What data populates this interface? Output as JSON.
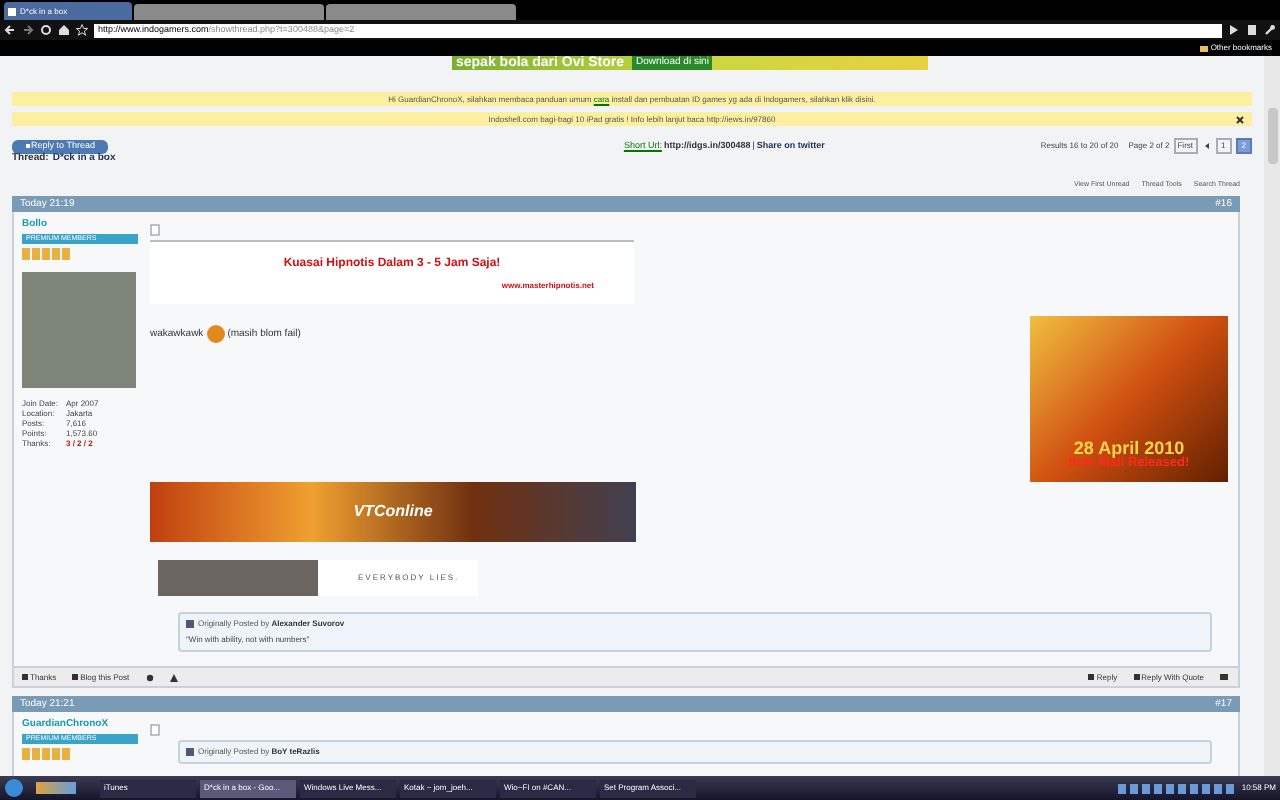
{
  "browser": {
    "tabs": [
      {
        "label": "D*ck in a box",
        "selected": true
      }
    ],
    "address_host": "http://www.indogamers.com",
    "address_path": "/showthread.php?t=300488&page=2",
    "bookmarks": [
      "Other bookmarks"
    ]
  },
  "ad_banner": {
    "text": "sepak bola dari Ovi Store",
    "button": "Download di sini"
  },
  "notices": [
    {
      "before": "Hi GuardianChronoX, silahkan membaca panduan umum ",
      "link": "cara",
      "after": " install dan pembuatan ID games yg ada di Indogamers, silahkan klik disini.",
      "closable": false
    },
    {
      "before": "Indoshell.com bagi-bagi 10 iPad gratis ! Info lebih lanjut baca http://iews.in/97860",
      "closable": true
    }
  ],
  "thread_bar": {
    "reply_button": "Reply to Thread",
    "short_url_label": "Short Url:",
    "short_url": "http://idgs.in/300488",
    "separator": "|",
    "share": "Share on twitter",
    "results": "Results 16 to 20 of 20",
    "page_label": "Page 2 of 2",
    "first": "First",
    "pages": [
      {
        "label": "1",
        "selected": false
      },
      {
        "label": "2",
        "selected": true
      }
    ]
  },
  "thread_title": {
    "label": "Thread:",
    "title": "D*ck in a box"
  },
  "thread_tools": [
    "View First Unread",
    "Thread Tools",
    "Search Thread"
  ],
  "posts": [
    {
      "date": "Today 21:19",
      "number": "#16",
      "user": "Bollo",
      "rank": "PREMIUM MEMBERS",
      "info": [
        {
          "label": "Join Date:",
          "value": "Apr 2007"
        },
        {
          "label": "Location:",
          "value": "Jakarta"
        },
        {
          "label": "Posts:",
          "value": "7,616"
        },
        {
          "label": "Points:",
          "value": "1,573.60"
        },
        {
          "label": "Thanks:",
          "value": "3 / 2 / 2"
        }
      ],
      "ad": {
        "title": "Kuasai Hipnotis Dalam 3 - 5 Jam Saja!",
        "url": "www.masterhipnotis.net"
      },
      "text": "wakawkawk",
      "text_after": "(masih blom fail)",
      "side_image": {
        "date": "28 April 2010",
        "caption": "Item Mall Released!"
      },
      "signature_banner": "VTConline",
      "signature_caption": "EVERYBODY LIES.",
      "quote": {
        "prefix": "Originally Posted by",
        "author": "Alexander Suvorov",
        "text": "\"Win with ability, not with numbers\""
      },
      "footer_left": [
        "Thanks",
        "Blog this Post"
      ],
      "footer_right": [
        "Reply",
        "Reply With Quote"
      ]
    },
    {
      "date": "Today 21:21",
      "number": "#17",
      "user": "GuardianChronoX",
      "rank": "PREMIUM MEMBERS",
      "quote": {
        "prefix": "Originally Posted by",
        "author": "BoY teRazlis"
      }
    }
  ],
  "taskbar": {
    "items": [
      {
        "label": "iTunes",
        "selected": false
      },
      {
        "label": "D*ck in a box - Goo...",
        "selected": true
      },
      {
        "label": "Windows Live Mess...",
        "selected": false
      },
      {
        "label": "Kotak ~ jom_joeh...",
        "selected": false
      },
      {
        "label": "Wio~FI on #CAN...",
        "selected": false
      },
      {
        "label": "Set Program Associ...",
        "selected": false
      }
    ],
    "time": "10:58 PM"
  }
}
